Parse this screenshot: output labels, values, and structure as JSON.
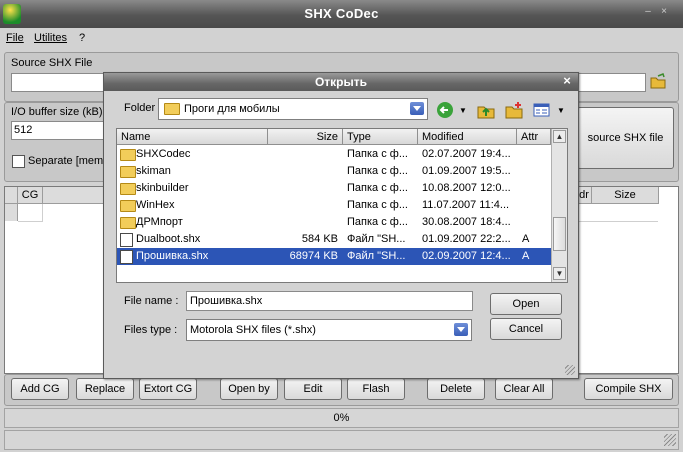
{
  "app": {
    "title": "SHX CoDec"
  },
  "menu": [
    {
      "label": "File"
    },
    {
      "label": "Utilites"
    },
    {
      "label": "?"
    }
  ],
  "source": {
    "label": "Source SHX File",
    "value": ""
  },
  "buffer": {
    "label": "I/O buffer size (kB)",
    "value": "512"
  },
  "separate": {
    "label": "Separate [mem",
    "checked": false
  },
  "open_source_button": "source SHX file",
  "cg_grid": {
    "headers": [
      "CG"
    ],
    "right_headers": [
      "dr",
      "Size"
    ]
  },
  "buttons": {
    "add_cg": "Add CG",
    "replace": "Replace",
    "extort_cg": "Extort CG",
    "open_by": "Open by",
    "edit": "Edit",
    "flash": "Flash",
    "delete": "Delete",
    "clear_all": "Clear All",
    "compile": "Compile SHX"
  },
  "progress": {
    "text": "0%",
    "value": 0
  },
  "dialog": {
    "title": "Открыть",
    "folder_label": "Folder",
    "folder_value": "Проги для мобилы",
    "columns": [
      "Name",
      "Size",
      "Type",
      "Modified",
      "Attr"
    ],
    "files": [
      {
        "name": "SHXCodec",
        "size": "",
        "type": "Папка с ф...",
        "modified": "02.07.2007 19:4...",
        "attr": "",
        "kind": "folder"
      },
      {
        "name": "skiman",
        "size": "",
        "type": "Папка с ф...",
        "modified": "01.09.2007 19:5...",
        "attr": "",
        "kind": "folder"
      },
      {
        "name": "skinbuilder",
        "size": "",
        "type": "Папка с ф...",
        "modified": "10.08.2007 12:0...",
        "attr": "",
        "kind": "folder"
      },
      {
        "name": "WinHex",
        "size": "",
        "type": "Папка с ф...",
        "modified": "11.07.2007 11:4...",
        "attr": "",
        "kind": "folder"
      },
      {
        "name": "ДРМпорт",
        "size": "",
        "type": "Папка с ф...",
        "modified": "30.08.2007 18:4...",
        "attr": "",
        "kind": "folder"
      },
      {
        "name": "Dualboot.shx",
        "size": "584 KB",
        "type": "Файл \"SH...",
        "modified": "01.09.2007 22:2...",
        "attr": "A",
        "kind": "file"
      },
      {
        "name": "Прошивка.shx",
        "size": "68974 KB",
        "type": "Файл \"SH...",
        "modified": "02.09.2007 12:4...",
        "attr": "A",
        "kind": "file",
        "selected": true
      }
    ],
    "file_name_label": "File name :",
    "file_name_value": "Прошивка.shx",
    "files_type_label": "Files type :",
    "files_type_value": "Motorola SHX files (*.shx)",
    "open_button": "Open",
    "cancel_button": "Cancel"
  }
}
